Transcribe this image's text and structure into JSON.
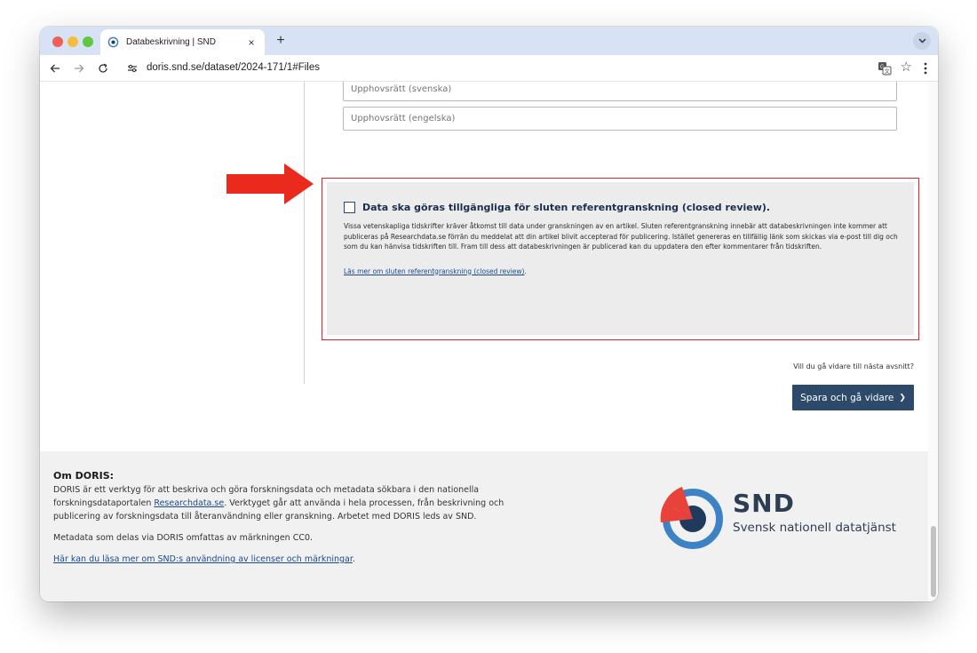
{
  "browser": {
    "tab_title": "Databeskrivning | SND",
    "tab_close": "×",
    "new_tab": "+",
    "url_host": "doris.snd.se",
    "url_path": "/dataset/2024-171/1#Files",
    "star": "☆"
  },
  "form": {
    "copyright_sv_placeholder": "Upphovsrätt (svenska)",
    "copyright_en_placeholder": "Upphovsrätt (engelska)"
  },
  "review": {
    "title": "Data ska göras tillgängliga för sluten referentgranskning (closed review).",
    "description": "Vissa vetenskapliga tidskrifter kräver åtkomst till data under granskningen av en artikel. Sluten referentgranskning innebär att databeskrivningen inte kommer att publiceras på Researchdata.se förrän du meddelat att din artikel blivit accepterad för publicering. Istället genereras en tillfällig länk som skickas via e-post till dig och som du kan hänvisa tidskriften till. Fram till dess att databeskrivningen är publicerad kan du uppdatera den efter kommentarer från tidskriften.",
    "link": "Läs mer om sluten referentgranskning (closed review)",
    "link_suffix": ".",
    "accent_color": "#e0252a"
  },
  "navigation": {
    "question": "Vill du gå vidare till nästa avsnitt?",
    "save_button": "Spara och gå vidare",
    "save_chevron": "❯"
  },
  "footer": {
    "title": "Om DORIS:",
    "p1_before": "DORIS är ett verktyg för att beskriva och göra forskningsdata och metadata sökbara i den nationella forskningsdataportalen ",
    "p1_link": "Researchdata.se",
    "p1_after": ". Verktyget går att använda i hela processen, från beskrivning och publicering av forskningsdata till återanvändning eller granskning. Arbetet med DORIS leds av SND.",
    "p2": "Metadata som delas via DORIS omfattas av märkningen CC0.",
    "p3_link": "Här kan du läsa mer om SND:s användning av licenser och märkningar",
    "p3_after": ".",
    "logo_word": "SND",
    "logo_sub": "Svensk nationell datatjänst"
  },
  "colors": {
    "button_bg": "#2e4a6b",
    "logo_red": "#e8423a",
    "logo_blue": "#3d82c4",
    "logo_navy": "#1f3a5c"
  }
}
